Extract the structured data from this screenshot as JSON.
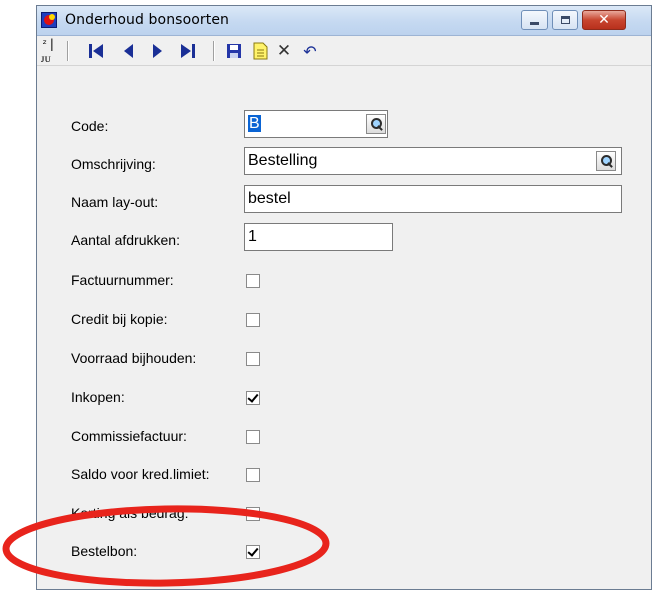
{
  "window": {
    "title": "Onderhoud bonsoorten",
    "close_glyph": "✕",
    "colors": {
      "title_gradient_top": "#dbe8f7",
      "close_red": "#c8452f",
      "annotation_red": "#e8241c"
    }
  },
  "toolbar": {
    "sort_label": "ᶻ|ᴊᴜ",
    "buttons": [
      {
        "icon": "sort-icon"
      },
      {
        "icon": "first-record-icon"
      },
      {
        "icon": "previous-record-icon"
      },
      {
        "icon": "next-record-icon"
      },
      {
        "icon": "last-record-icon"
      },
      {
        "icon": "save-icon"
      },
      {
        "icon": "new-document-icon"
      },
      {
        "icon": "delete-icon"
      },
      {
        "icon": "undo-icon"
      }
    ],
    "delete_glyph": "✕",
    "undo_glyph": "↶"
  },
  "form": {
    "code": {
      "label": "Code:",
      "value": "B"
    },
    "omschrijving": {
      "label": "Omschrijving:",
      "value": "Bestelling"
    },
    "naam_layout": {
      "label": "Naam lay-out:",
      "value": "bestel"
    },
    "aantal_afdrukken": {
      "label": "Aantal afdrukken:",
      "value": "1"
    },
    "checkboxes": [
      {
        "label": "Factuurnummer:",
        "checked": false
      },
      {
        "label": "Credit bij kopie:",
        "checked": false
      },
      {
        "label": "Voorraad bijhouden:",
        "checked": false
      },
      {
        "label": "Inkopen:",
        "checked": true
      },
      {
        "label": "Commissiefactuur:",
        "checked": false
      },
      {
        "label": "Saldo voor kred.limiet:",
        "checked": false
      },
      {
        "label": "Korting als bedrag:",
        "checked": false
      },
      {
        "label": "Bestelbon:",
        "checked": true
      }
    ]
  }
}
